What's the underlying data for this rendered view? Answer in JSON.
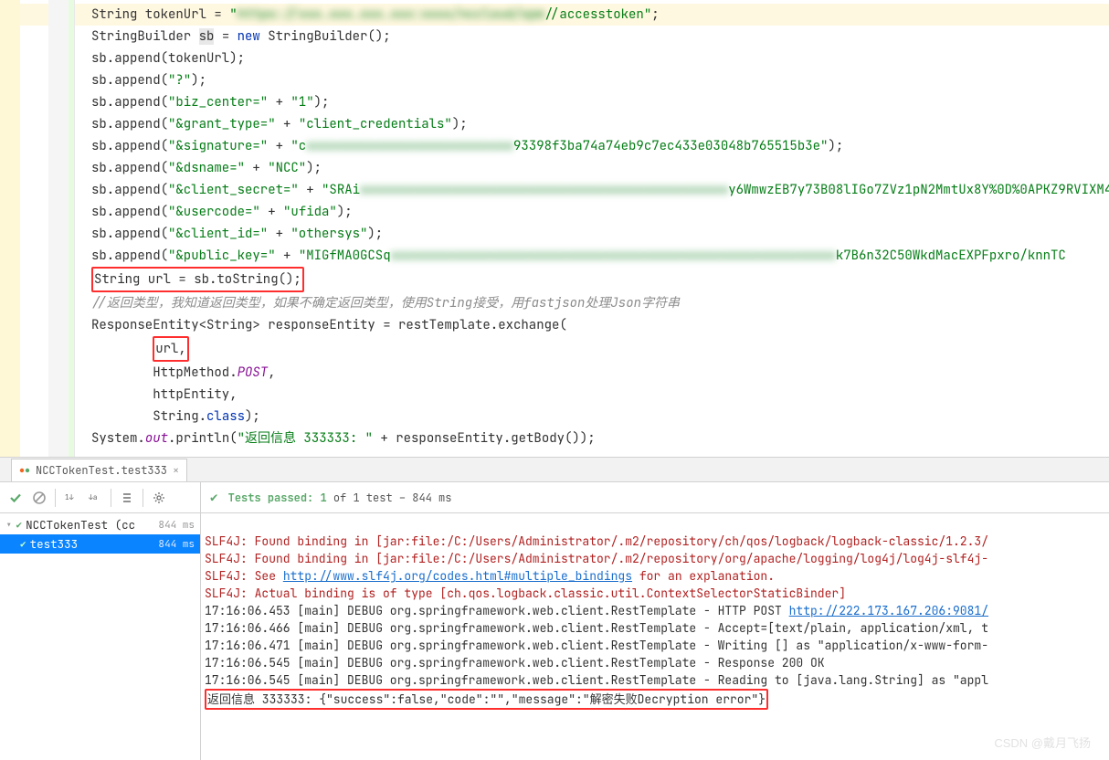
{
  "code": {
    "line1a": "String tokenUrl = ",
    "line1b": "\"",
    "line1_blur": "https://xxx.xxx.xxx.xxx:xxxx/nccloud/opm/",
    "line1c": "/accesstoken\"",
    "line1d": ";",
    "line2a": "StringBuilder ",
    "line2_var": "sb",
    "line2b": " = ",
    "line2_new": "new",
    "line2c": " StringBuilder();",
    "line3": "sb.append(tokenUrl);",
    "line4a": "sb.append(",
    "line4b": "\"?\"",
    "line4c": ");",
    "line5a": "sb.append(",
    "line5b": "\"biz_center=\"",
    "line5c": " + ",
    "line5d": "\"1\"",
    "line5e": ");",
    "line6a": "sb.append(",
    "line6b": "\"&grant_type=\"",
    "line6c": " + ",
    "line6d": "\"client_credentials\"",
    "line6e": ");",
    "line7a": "sb.append(",
    "line7b": "\"&signature=\"",
    "line7c": " + ",
    "line7d": "\"c",
    "line7_blur": "xxxxxxxxxxxxxxxxxxxxxxxxxxx",
    "line7e": "93398f3ba74a74eb9c7ec433e03048b765515b3e\"",
    "line7f": ");",
    "line8a": "sb.append(",
    "line8b": "\"&dsname=\"",
    "line8c": " + ",
    "line8d": "\"NCC\"",
    "line8e": ");",
    "line9a": "sb.append(",
    "line9b": "\"&client_secret=\"",
    "line9c": " + ",
    "line9d": "\"SRAi",
    "line9_blur": "xxxxxxxxxxxxxxxxxxxxxxxxxxxxxxxxxxxxxxxxxxxxxxxx",
    "line9e": "y6WmwzEB7y73B08lIGo7ZVz1pN2MmtUx8Y%0D%0APKZ9RVIXM4",
    "line10a": "sb.append(",
    "line10b": "\"&usercode=\"",
    "line10c": " + ",
    "line10d": "\"ufida\"",
    "line10e": ");",
    "line11a": "sb.append(",
    "line11b": "\"&client_id=\"",
    "line11c": " + ",
    "line11d": "\"othersys\"",
    "line11e": ");",
    "line12a": "sb.append(",
    "line12b": "\"&public_key=\"",
    "line12c": " + ",
    "line12d": "\"MIGfMA0GCSq",
    "line12_blur": "xxxxxxxxxxxxxxxxxxxxxxxxxxxxxxxxxxxxxxxxxxxxxxxxxxxxxxxxxx",
    "line12e": "k7B6n32C50WkdMacEXPFpxro/knnTC",
    "line13": "String url = sb.toString();",
    "line14": "//返回类型，我知道返回类型，如果不确定返回类型，使用String接受，用fastjson处理Json字符串",
    "line15": "ResponseEntity<String> responseEntity = restTemplate.exchange(",
    "line16": "url,",
    "line17a": "HttpMethod.",
    "line17b": "POST",
    "line17c": ",",
    "line18": "httpEntity,",
    "line19a": "String.",
    "line19b": "class",
    "line19c": ");",
    "line20a": "System.",
    "line20b": "out",
    "line20c": ".println(",
    "line20d": "\"返回信息 333333: \"",
    "line20e": " + responseEntity.getBody());"
  },
  "tab": {
    "label": "NCCTokenTest.test333"
  },
  "status": {
    "text_prefix": "Tests passed: 1",
    "text_suffix": " of 1 test – 844 ms"
  },
  "tree": {
    "row1": {
      "label": "NCCTokenTest (cc",
      "ms": "844 ms"
    },
    "row2": {
      "label": "test333",
      "ms": "844 ms"
    }
  },
  "console": {
    "l1a": "SLF4J: Found binding in [jar:file:/C:/Users/Administrator/.m2/repository/ch/qos/logback/logback-classic/1.2.3/",
    "l2a": "SLF4J: Found binding in [jar:file:/C:/Users/Administrator/.m2/repository/org/apache/logging/log4j/log4j-slf4j-",
    "l3a": "SLF4J: See ",
    "l3_link": "http://www.slf4j.org/codes.html#multiple_bindings",
    "l3b": " for an explanation.",
    "l4a": "SLF4J: Actual binding is of type [ch.qos.logback.classic.util.ContextSelectorStaticBinder]",
    "l5a": "17:16:06.453 [main] DEBUG org.springframework.web.client.RestTemplate - HTTP POST ",
    "l5_link": "http://222.173.167.206:9081/",
    "l6": "17:16:06.466 [main] DEBUG org.springframework.web.client.RestTemplate - Accept=[text/plain, application/xml, t",
    "l7": "17:16:06.471 [main] DEBUG org.springframework.web.client.RestTemplate - Writing [] as \"application/x-www-form-",
    "l8": "17:16:06.545 [main] DEBUG org.springframework.web.client.RestTemplate - Response 200 OK",
    "l9": "17:16:06.545 [main] DEBUG org.springframework.web.client.RestTemplate - Reading to [java.lang.String] as \"appl",
    "l10": "返回信息 333333: {\"success\":false,\"code\":\"\",\"message\":\"解密失败Decryption error\"}"
  },
  "watermark": "CSDN @戴月飞扬"
}
